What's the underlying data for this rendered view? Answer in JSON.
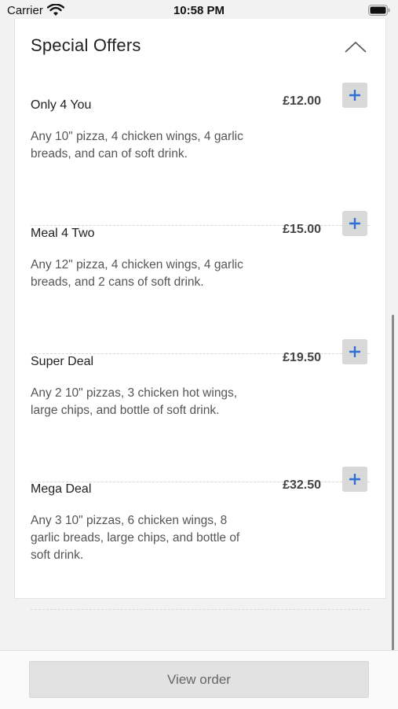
{
  "status_bar": {
    "carrier": "Carrier",
    "time": "10:58 PM",
    "wifi_icon": "wifi-icon",
    "battery_icon": "battery-icon"
  },
  "section": {
    "title": "Special Offers",
    "chevron_icon": "chevron-up-icon",
    "expanded": true
  },
  "offers": [
    {
      "name": "Only 4 You",
      "price": "£12.00",
      "description": "Any 10\" pizza, 4 chicken wings, 4 garlic breads, and can of soft drink."
    },
    {
      "name": "Meal 4 Two",
      "price": "£15.00",
      "description": "Any 12\" pizza, 4 chicken wings, 4 garlic breads, and 2 cans of soft drink."
    },
    {
      "name": "Super Deal",
      "price": "£19.50",
      "description": "Any 2 10\" pizzas, 3 chicken hot wings, large chips, and bottle of soft drink."
    },
    {
      "name": "Mega Deal",
      "price": "£32.50",
      "description": "Any 3 10\" pizzas, 6 chicken wings, 8 garlic breads, large chips, and bottle of soft drink."
    }
  ],
  "add_icon": "plus-icon",
  "colors": {
    "accent": "#2f6fd6",
    "add_button_bg": "#d9d9d9"
  },
  "footer": {
    "view_order_label": "View order"
  }
}
